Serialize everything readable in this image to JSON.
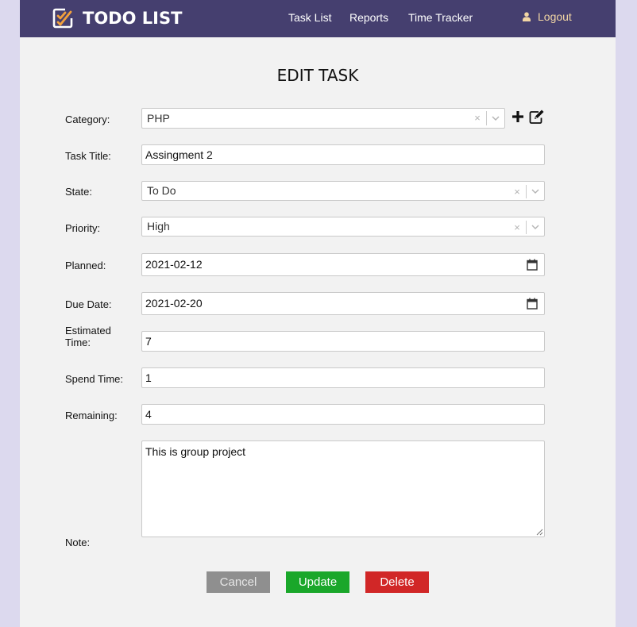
{
  "app": {
    "title": "TODO LIST"
  },
  "nav": {
    "items": [
      {
        "label": "Task List"
      },
      {
        "label": "Reports"
      },
      {
        "label": "Time Tracker"
      }
    ],
    "logout_label": "Logout"
  },
  "form": {
    "title": "EDIT TASK",
    "category": {
      "label": "Category:",
      "value": "PHP",
      "clear_glyph": "×"
    },
    "task_title": {
      "label": "Task Title:",
      "value": "Assingment 2"
    },
    "state": {
      "label": "State:",
      "value": "To Do",
      "clear_glyph": "×"
    },
    "priority": {
      "label": "Priority:",
      "value": "High",
      "clear_glyph": "×"
    },
    "planned": {
      "label": "Planned:",
      "value": "2021-02-12"
    },
    "due_date": {
      "label": "Due Date:",
      "value": "2021-02-20"
    },
    "estimated_time": {
      "label_line1": "Estimated",
      "label_line2": "Time:",
      "value": "7"
    },
    "spend_time": {
      "label": "Spend Time:",
      "value": "1"
    },
    "remaining": {
      "label": "Remaining:",
      "value": "4"
    },
    "note": {
      "label": "Note:",
      "value": "This is group project"
    }
  },
  "buttons": {
    "cancel": "Cancel",
    "update": "Update",
    "delete": "Delete"
  },
  "colors": {
    "navbar": "#453f6f",
    "logout": "#f2d6a4",
    "update": "#1aa72a",
    "delete": "#d12727",
    "cancel": "#8f8f8f"
  },
  "icons": [
    "checklist-logo-icon",
    "user-icon",
    "plus-icon",
    "edit-icon",
    "chevron-down-icon",
    "calendar-icon"
  ]
}
